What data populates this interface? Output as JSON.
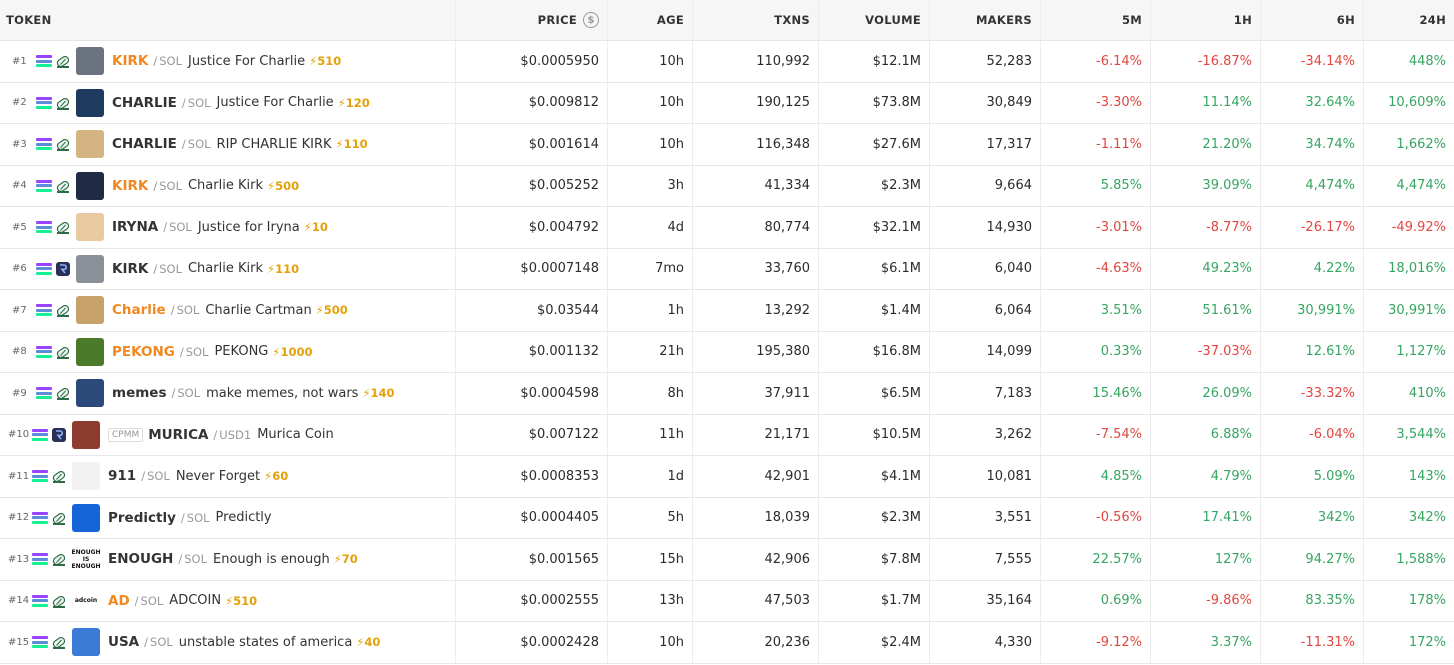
{
  "headers": {
    "token": "TOKEN",
    "price": "PRICE",
    "age": "AGE",
    "txns": "TXNS",
    "volume": "VOLUME",
    "makers": "MAKERS",
    "m5": "5M",
    "h1": "1H",
    "h6": "6H",
    "h24": "24H"
  },
  "colors": {
    "negative": "#e2463f",
    "positive": "#36a561",
    "highlight_symbol": "#f0871f",
    "boost": "#e3a008"
  },
  "rows": [
    {
      "rank": "#1",
      "dex": "pump-icon",
      "avatar_color": "#6b7280",
      "avatar_text": "",
      "cpmm": "",
      "symbol": "KIRK",
      "highlight": true,
      "quote": "SOL",
      "name": "Justice For Charlie",
      "boost": "510",
      "price": "$0.0005950",
      "age": "10h",
      "txns": "110,992",
      "volume": "$12.1M",
      "makers": "52,283",
      "m5": "-6.14%",
      "h1": "-16.87%",
      "h6": "-34.14%",
      "h24": "448%"
    },
    {
      "rank": "#2",
      "dex": "pump-icon",
      "avatar_color": "#1e3a5f",
      "avatar_text": "",
      "cpmm": "",
      "symbol": "CHARLIE",
      "highlight": false,
      "quote": "SOL",
      "name": "Justice For Charlie",
      "boost": "120",
      "price": "$0.009812",
      "age": "10h",
      "txns": "190,125",
      "volume": "$73.8M",
      "makers": "30,849",
      "m5": "-3.30%",
      "h1": "11.14%",
      "h6": "32.64%",
      "h24": "10,609%"
    },
    {
      "rank": "#3",
      "dex": "pump-icon",
      "avatar_color": "#d4b483",
      "avatar_text": "",
      "cpmm": "",
      "symbol": "CHARLIE",
      "highlight": false,
      "quote": "SOL",
      "name": "RIP CHARLIE KIRK",
      "boost": "110",
      "price": "$0.001614",
      "age": "10h",
      "txns": "116,348",
      "volume": "$27.6M",
      "makers": "17,317",
      "m5": "-1.11%",
      "h1": "21.20%",
      "h6": "34.74%",
      "h24": "1,662%"
    },
    {
      "rank": "#4",
      "dex": "pump-icon",
      "avatar_color": "#1f2a44",
      "avatar_text": "",
      "cpmm": "",
      "symbol": "KIRK",
      "highlight": true,
      "quote": "SOL",
      "name": "Charlie Kirk",
      "boost": "500",
      "price": "$0.005252",
      "age": "3h",
      "txns": "41,334",
      "volume": "$2.3M",
      "makers": "9,664",
      "m5": "5.85%",
      "h1": "39.09%",
      "h6": "4,474%",
      "h24": "4,474%"
    },
    {
      "rank": "#5",
      "dex": "pump-icon",
      "avatar_color": "#e8c9a0",
      "avatar_text": "",
      "cpmm": "",
      "symbol": "IRYNA",
      "highlight": false,
      "quote": "SOL",
      "name": "Justice for Iryna",
      "boost": "10",
      "price": "$0.004792",
      "age": "4d",
      "txns": "80,774",
      "volume": "$32.1M",
      "makers": "14,930",
      "m5": "-3.01%",
      "h1": "-8.77%",
      "h6": "-26.17%",
      "h24": "-49.92%"
    },
    {
      "rank": "#6",
      "dex": "raydium-icon",
      "avatar_color": "#8a8f98",
      "avatar_text": "",
      "cpmm": "",
      "symbol": "KIRK",
      "highlight": false,
      "quote": "SOL",
      "name": "Charlie Kirk",
      "boost": "110",
      "price": "$0.0007148",
      "age": "7mo",
      "txns": "33,760",
      "volume": "$6.1M",
      "makers": "6,040",
      "m5": "-4.63%",
      "h1": "49.23%",
      "h6": "4.22%",
      "h24": "18,016%"
    },
    {
      "rank": "#7",
      "dex": "pump-icon",
      "avatar_color": "#c9a26b",
      "avatar_text": "",
      "cpmm": "",
      "symbol": "Charlie",
      "highlight": true,
      "quote": "SOL",
      "name": "Charlie Cartman",
      "boost": "500",
      "price": "$0.03544",
      "age": "1h",
      "txns": "13,292",
      "volume": "$1.4M",
      "makers": "6,064",
      "m5": "3.51%",
      "h1": "51.61%",
      "h6": "30,991%",
      "h24": "30,991%"
    },
    {
      "rank": "#8",
      "dex": "pump-icon",
      "avatar_color": "#4a7a2a",
      "avatar_text": "",
      "cpmm": "",
      "symbol": "PEKONG",
      "highlight": true,
      "quote": "SOL",
      "name": "PEKONG",
      "boost": "1000",
      "price": "$0.001132",
      "age": "21h",
      "txns": "195,380",
      "volume": "$16.8M",
      "makers": "14,099",
      "m5": "0.33%",
      "h1": "-37.03%",
      "h6": "12.61%",
      "h24": "1,127%"
    },
    {
      "rank": "#9",
      "dex": "pump-icon",
      "avatar_color": "#2b4a7a",
      "avatar_text": "",
      "cpmm": "",
      "symbol": "memes",
      "highlight": false,
      "quote": "SOL",
      "name": "make memes, not wars",
      "boost": "140",
      "price": "$0.0004598",
      "age": "8h",
      "txns": "37,911",
      "volume": "$6.5M",
      "makers": "7,183",
      "m5": "15.46%",
      "h1": "26.09%",
      "h6": "-33.32%",
      "h24": "410%"
    },
    {
      "rank": "#10",
      "dex": "raydium-icon",
      "avatar_color": "#8c3b2e",
      "avatar_text": "",
      "cpmm": "CPMM",
      "symbol": "MURICA",
      "highlight": false,
      "quote": "USD1",
      "name": "Murica Coin",
      "boost": "",
      "price": "$0.007122",
      "age": "11h",
      "txns": "21,171",
      "volume": "$10.5M",
      "makers": "3,262",
      "m5": "-7.54%",
      "h1": "6.88%",
      "h6": "-6.04%",
      "h24": "3,544%"
    },
    {
      "rank": "#11",
      "dex": "pump-icon",
      "avatar_color": "#f2f2f2",
      "avatar_text": "",
      "cpmm": "",
      "symbol": "911",
      "highlight": false,
      "quote": "SOL",
      "name": "Never Forget",
      "boost": "60",
      "price": "$0.0008353",
      "age": "1d",
      "txns": "42,901",
      "volume": "$4.1M",
      "makers": "10,081",
      "m5": "4.85%",
      "h1": "4.79%",
      "h6": "5.09%",
      "h24": "143%"
    },
    {
      "rank": "#12",
      "dex": "pump-icon",
      "avatar_color": "#1565d8",
      "avatar_text": "",
      "cpmm": "",
      "symbol": "Predictly",
      "highlight": false,
      "quote": "SOL",
      "name": "Predictly",
      "boost": "",
      "price": "$0.0004405",
      "age": "5h",
      "txns": "18,039",
      "volume": "$2.3M",
      "makers": "3,551",
      "m5": "-0.56%",
      "h1": "17.41%",
      "h6": "342%",
      "h24": "342%"
    },
    {
      "rank": "#13",
      "dex": "pump-icon",
      "avatar_color": "#ffffff",
      "avatar_text": "ENOUGH IS ENOUGH",
      "cpmm": "",
      "symbol": "ENOUGH",
      "highlight": false,
      "quote": "SOL",
      "name": "Enough is enough",
      "boost": "70",
      "price": "$0.001565",
      "age": "15h",
      "txns": "42,906",
      "volume": "$7.8M",
      "makers": "7,555",
      "m5": "22.57%",
      "h1": "127%",
      "h6": "94.27%",
      "h24": "1,588%"
    },
    {
      "rank": "#14",
      "dex": "pump-icon",
      "avatar_color": "#ffffff",
      "avatar_text": "adcoin",
      "cpmm": "",
      "symbol": "AD",
      "highlight": true,
      "quote": "SOL",
      "name": "ADCOIN",
      "boost": "510",
      "price": "$0.0002555",
      "age": "13h",
      "txns": "47,503",
      "volume": "$1.7M",
      "makers": "35,164",
      "m5": "0.69%",
      "h1": "-9.86%",
      "h6": "83.35%",
      "h24": "178%"
    },
    {
      "rank": "#15",
      "dex": "pump-icon",
      "avatar_color": "#3a7bd5",
      "avatar_text": "",
      "cpmm": "",
      "symbol": "USA",
      "highlight": false,
      "quote": "SOL",
      "name": "unstable states of america",
      "boost": "40",
      "price": "$0.0002428",
      "age": "10h",
      "txns": "20,236",
      "volume": "$2.4M",
      "makers": "4,330",
      "m5": "-9.12%",
      "h1": "3.37%",
      "h6": "-11.31%",
      "h24": "172%"
    }
  ]
}
